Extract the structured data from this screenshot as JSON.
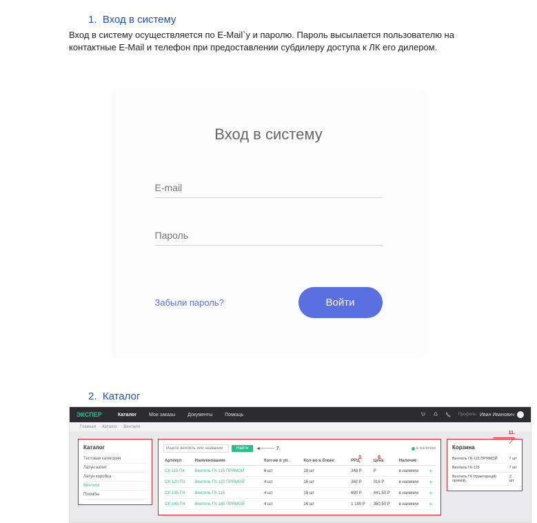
{
  "section1": {
    "number": "1.",
    "title": "Вход в систему",
    "text": "Вход в систему осуществляется по E-Mail`у и паролю. Пароль высылается пользователю на контактные E-Mail и телефон при предоставлении субдилеру доступа к ЛК его дилером."
  },
  "login": {
    "title": "Вход в систему",
    "email_placeholder": "E-mail",
    "password_placeholder": "Пароль",
    "forgot": "Забыли пароль?",
    "submit": "Войти"
  },
  "section2": {
    "number": "2.",
    "title": "Каталог"
  },
  "catalog": {
    "logo": "ЭКСПЕР",
    "nav": {
      "n1": "Каталог",
      "n2": "Мои заказы",
      "n3": "Документы",
      "n4": "Помощь"
    },
    "user": "Иван Иванович",
    "breadcrumb": {
      "b1": "Главная",
      "b2": "Каталог",
      "b3": "Вентиля"
    },
    "sidebar": {
      "title": "Каталог",
      "items": {
        "c0": "Тестовая категория",
        "c1": "Латун напит",
        "c2": "Латун коробка",
        "c3": "Вентиля",
        "c4": "Пломбы"
      }
    },
    "search": {
      "placeholder": "Ищите вентиль или название",
      "button": "Найти"
    },
    "callouts": {
      "n3": "3.",
      "n7": "7.",
      "n8": "8.",
      "n11": "11."
    },
    "stock_label": "в наличии",
    "table": {
      "headers": {
        "h0": "Артикул",
        "h1": "Наименование",
        "h2": "Кол-во в уп.",
        "h3": "Кол-во в блоке",
        "h4": "РРЦ",
        "h5": "Цена",
        "h6": "Наличие"
      },
      "rows": {
        "r0": {
          "art": "СК-115 П4",
          "name": "Вентиль ГК-115 ПРЯМОЙ",
          "pack": "6 шт",
          "box": "18 шт",
          "rrc": "348 Р",
          "price": "Р",
          "stock": "в наличии"
        },
        "r1": {
          "art": "СК-120 П3",
          "name": "Вентиль ГК-120 ПРЯМОЙ",
          "pack": "4 шт",
          "box": "16 шт",
          "rrc": "360 Р",
          "price": "016 Р",
          "stock": "в наличии"
        },
        "r2": {
          "art": "СК-135 П4",
          "name": "Вентиль ГК-115",
          "pack": "4 шт",
          "box": "15 шт",
          "rrc": "690 Р",
          "price": "441,50 Р",
          "stock": "в наличии"
        },
        "r3": {
          "art": "СК-145 П4",
          "name": "Вентиль ГК-145 ПРЯМОЙ",
          "pack": "4 шт",
          "box": "16 шт",
          "rrc": "1 190 Р",
          "price": "350,50 Р",
          "stock": "в наличии"
        }
      }
    },
    "cart": {
      "title": "Корзина",
      "items": {
        "i0": {
          "name": "Вентиль ГК-115 ПРЯМОЙ",
          "qty": "7 шт"
        },
        "i1": {
          "name": "Вентиль ГК-115",
          "qty": "7 шт"
        },
        "i2": {
          "name": "Вентиль ГК (тракторный) прямой,",
          "qty": "2 шт"
        }
      }
    }
  }
}
